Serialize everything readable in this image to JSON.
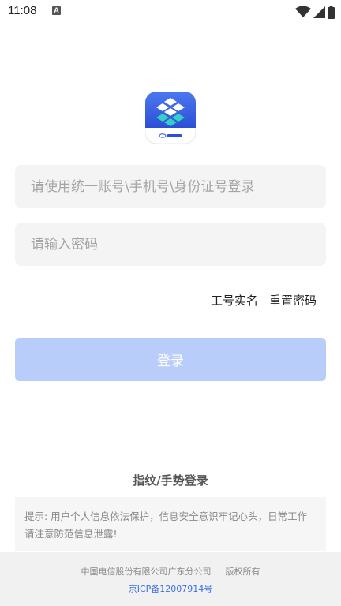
{
  "status_bar": {
    "time": "11:08",
    "notification_icon": "a-letter-icon",
    "icons": [
      "wifi-icon",
      "signal-icon",
      "battery-icon"
    ]
  },
  "logo": {
    "icon": "china-telecom-app-logo",
    "colors": {
      "primary": "#3a63e8",
      "accent": "#33d1c3"
    }
  },
  "login_form": {
    "account_placeholder": "请使用统一账号\\手机号\\身份证号登录",
    "account_value": "",
    "password_placeholder": "请输入密码",
    "password_value": "",
    "link_realname": "工号实名",
    "link_reset": "重置密码",
    "login_label": "登录",
    "login_button_color": "#b9cdfa"
  },
  "gesture_login": "指纹/手势登录",
  "tip": "提示: 用户个人信息依法保护，信息安全意识牢记心头，日常工作请注意防范信息泄露!",
  "footer": {
    "company": "中国电信股份有限公司广东分公司",
    "rights": "版权所有",
    "icp": "京ICP备12007914号",
    "link_color": "#3b6fe0"
  }
}
